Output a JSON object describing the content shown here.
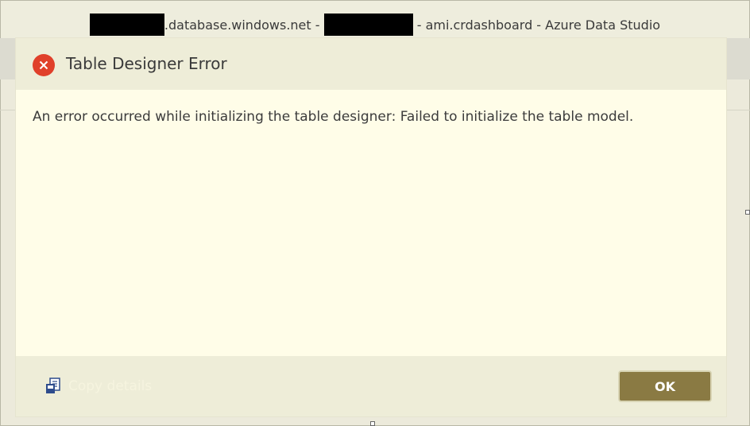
{
  "window": {
    "title_part1": ".database.windows.net -",
    "title_part2": "- ami.crdashboard - Azure Data Studio"
  },
  "dialog": {
    "title": "Table Designer Error",
    "message": "An error occurred while initializing the table designer: Failed to initialize the table model.",
    "icon": "error-icon",
    "copy_details_label": "Copy details",
    "copy_details_icon": "copy-icon",
    "ok_label": "OK"
  },
  "colors": {
    "error": "#e0402a",
    "ok_button": "#8a7a43",
    "dialog_bg": "#fffde8",
    "header_bg": "#eeedd8"
  }
}
